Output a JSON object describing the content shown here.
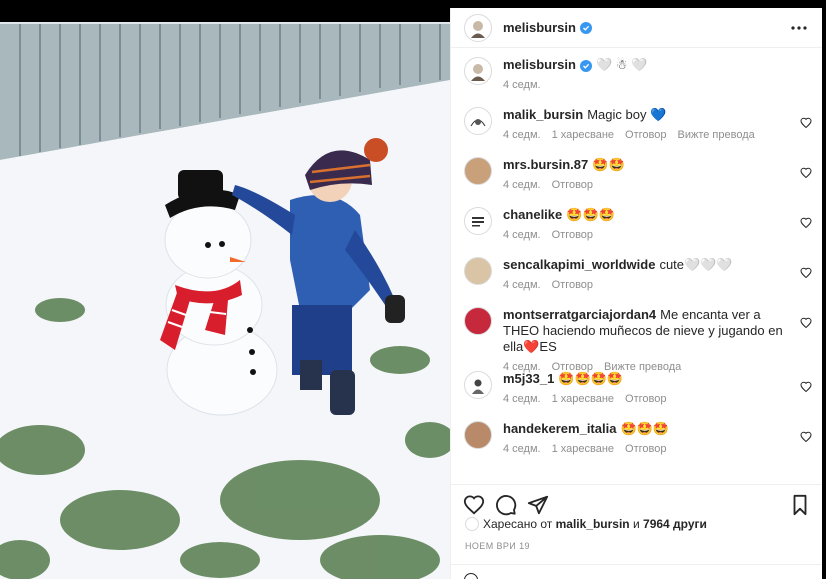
{
  "post": {
    "author": "melisbursin",
    "caption_suffix": "🤍 ☃ 🤍",
    "caption_time": "4 седм."
  },
  "icons": {
    "more": "more-horizontal-icon",
    "like": "heart-outline-icon",
    "comment": "speech-bubble-icon",
    "share": "paper-plane-icon",
    "save": "bookmark-icon",
    "verified": "verified-badge-icon",
    "emoji": "smiley-icon"
  },
  "colors": {
    "accent": "#3897f0",
    "meta_text": "#8e8e8e",
    "text": "#262626"
  },
  "comments": [
    {
      "user": "malik_bursin",
      "text": "Magic boy 💙",
      "time": "4 седм.",
      "likes": "1 харесване",
      "reply": "Отговор",
      "translate": "Вижте превода"
    },
    {
      "user": "mrs.bursin.87",
      "text": "🤩🤩",
      "time": "4 седм.",
      "reply": "Отговор"
    },
    {
      "user": "chanelike",
      "text": "🤩🤩🤩",
      "time": "4 седм.",
      "reply": "Отговор"
    },
    {
      "user": "sencalkapimi_worldwide",
      "text": "cute🤍🤍🤍",
      "time": "4 седм.",
      "reply": "Отговор"
    },
    {
      "user": "montserratgarciajordan4",
      "text": "Me encanta ver a THEO haciendo muñecos de nieve y jugando en ella❤️ES",
      "time": "4 седм.",
      "reply": "Отговор",
      "translate": "Вижте превода"
    },
    {
      "user": "m5j33_1",
      "text": "🤩🤩🤩🤩",
      "time": "4 седм.",
      "likes": "1 харесване",
      "reply": "Отговор"
    },
    {
      "user": "handekerem_italia",
      "text": "🤩🤩🤩",
      "time": "4 седм.",
      "likes": "1 харесване",
      "reply": "Отговор"
    }
  ],
  "likes_line": {
    "prefix": "Харесано от",
    "user": "malik_bursin",
    "conj": "и",
    "count": "7964 други"
  },
  "date": "НОЕМ ВРИ 19"
}
